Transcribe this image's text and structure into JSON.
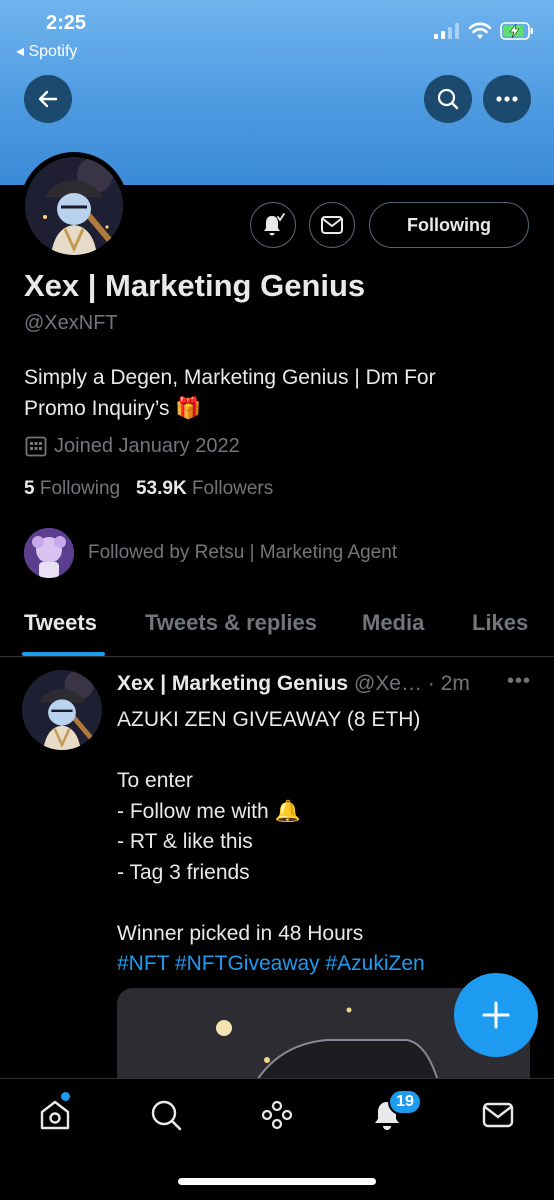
{
  "status_bar": {
    "time": "2:25",
    "back_app": "◂ Spotify"
  },
  "profile": {
    "name": "Xex | Marketing Genius",
    "handle": "@XexNFT",
    "bio_line1": "Simply a Degen, Marketing Genius | Dm For",
    "bio_line2": "Promo Inquiry’s",
    "bio_emoji": "🎁",
    "joined": "Joined January 2022",
    "following_count": "5",
    "following_label": "Following",
    "followers_count": "53.9K",
    "followers_label": "Followers",
    "followed_by": "Followed by Retsu | Marketing Agent",
    "follow_button": "Following"
  },
  "tabs": [
    "Tweets",
    "Tweets & replies",
    "Media",
    "Likes"
  ],
  "active_tab": "Tweets",
  "tweet": {
    "name": "Xex | Marketing Genius",
    "handle_time": "@Xe… · 2m",
    "more": "•••",
    "line1": "AZUKI ZEN GIVEAWAY (8 ETH)",
    "line2": "To enter",
    "line3": "- Follow me with 🔔",
    "line4": "- RT & like this",
    "line5": "- Tag 3 friends",
    "line6": "Winner picked in 48 Hours",
    "hashtags": "#NFT #NFTGiveaway #AzukiZen"
  },
  "nav": {
    "notifications_badge": "19"
  },
  "colors": {
    "accent": "#1d9bf0",
    "banner": "#4c99e0",
    "muted": "#71767b"
  }
}
